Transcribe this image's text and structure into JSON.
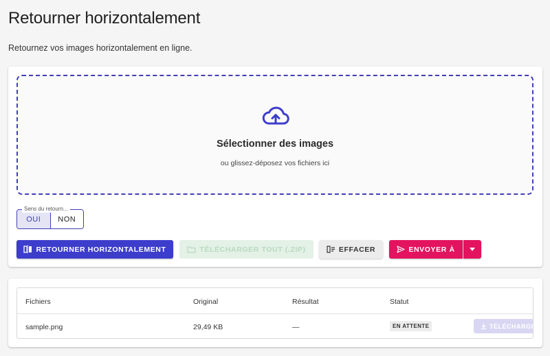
{
  "header": {
    "title": "Retourner horizontalement",
    "subtitle": "Retournez vos images horizontalement en ligne."
  },
  "dropzone": {
    "icon": "cloud-upload-icon",
    "title": "Sélectionner des images",
    "subtitle": "ou glissez-déposez vos fichiers ici"
  },
  "toggle": {
    "legend": "Sens du retourn...",
    "options": [
      "OUI",
      "NON"
    ],
    "selected": "OUI"
  },
  "actions": {
    "flip_label": "RETOURNER HORIZONTALEMENT",
    "download_all_label": "TÉLÉCHARGER TOUT (.ZIP)",
    "clear_label": "EFFACER",
    "send_label": "ENVOYER À"
  },
  "table": {
    "columns": [
      "Fichiers",
      "Original",
      "Résultat",
      "Statut"
    ],
    "rows": [
      {
        "file": "sample.png",
        "original": "29,49 KB",
        "result": "—",
        "status": "EN ATTENTE",
        "download_label": "TÉLÉCHARGER"
      }
    ]
  },
  "colors": {
    "primary": "#3d3dcc",
    "send": "#e3135f",
    "dropzone_border": "#3f3fb5"
  }
}
